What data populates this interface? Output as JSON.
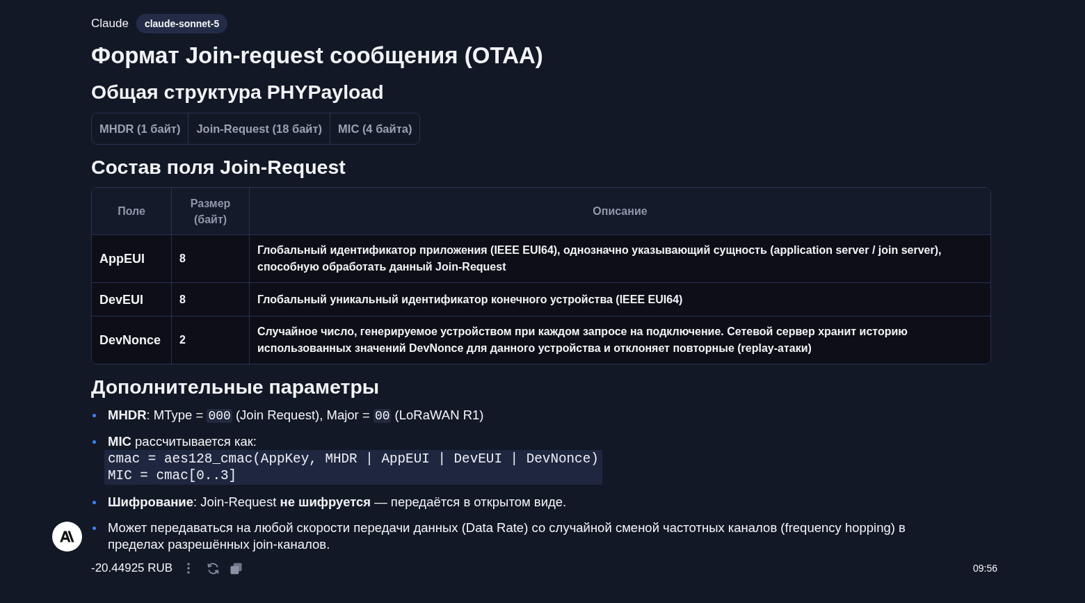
{
  "header": {
    "author": "Claude",
    "model_badge": "claude-sonnet-5"
  },
  "title": "Формат Join-request сообщения (OTAA)",
  "structure": {
    "heading": "Общая структура PHYPayload",
    "segments": [
      "MHDR (1 байт)",
      "Join-Request (18 байт)",
      "MIC (4 байта)"
    ]
  },
  "fields": {
    "heading": "Состав поля Join-Request",
    "table": {
      "columns": [
        "Поле",
        "Размер (байт)",
        "Описание"
      ],
      "rows": [
        [
          "AppEUI",
          "8",
          "Глобальный идентификатор приложения (IEEE EUI64), однозначно указывающий сущность (application server / join server), способную обработать данный Join-Request"
        ],
        [
          "DevEUI",
          "8",
          "Глобальный уникальный идентификатор конечного устройства (IEEE EUI64)"
        ],
        [
          "DevNonce",
          "2",
          "Случайное число, генерируемое устройством при каждом запросе на подключение. Сетевой сервер хранит историю использованных значений DevNonce для данного устройства и отклоняет повторные (replay-атаки)"
        ]
      ]
    }
  },
  "params": {
    "heading": "Дополнительные параметры",
    "items": [
      {
        "parts": [
          {
            "kind": "text",
            "text": "**MHDR**: MType = "
          },
          {
            "kind": "code",
            "text": "000"
          },
          {
            "kind": "text",
            "text": " (Join Request), Major = "
          },
          {
            "kind": "code",
            "text": "00"
          },
          {
            "kind": "text",
            "text": " (LoRaWAN R1)"
          }
        ]
      },
      {
        "parts": [
          {
            "kind": "text",
            "text": "**MIC** рассчитывается как:"
          }
        ],
        "code_block": [
          "cmac = aes128_cmac(AppKey, MHDR | AppEUI | DevEUI | DevNonce)",
          "MIC = cmac[0..3]"
        ]
      },
      {
        "parts": [
          {
            "kind": "text",
            "text": "**Шифрование**: Join-Request **не шифруется** — передаётся в открытом виде."
          }
        ]
      },
      {
        "parts": [
          {
            "kind": "text",
            "text": "Может передаваться на любой скорости передачи данных (Data Rate) со случайной сменой частотных каналов (frequency hopping) в пределах разрешённых join-каналов."
          }
        ]
      }
    ]
  },
  "footer": {
    "cost": "-20.44925 RUB",
    "time": "09:56"
  }
}
